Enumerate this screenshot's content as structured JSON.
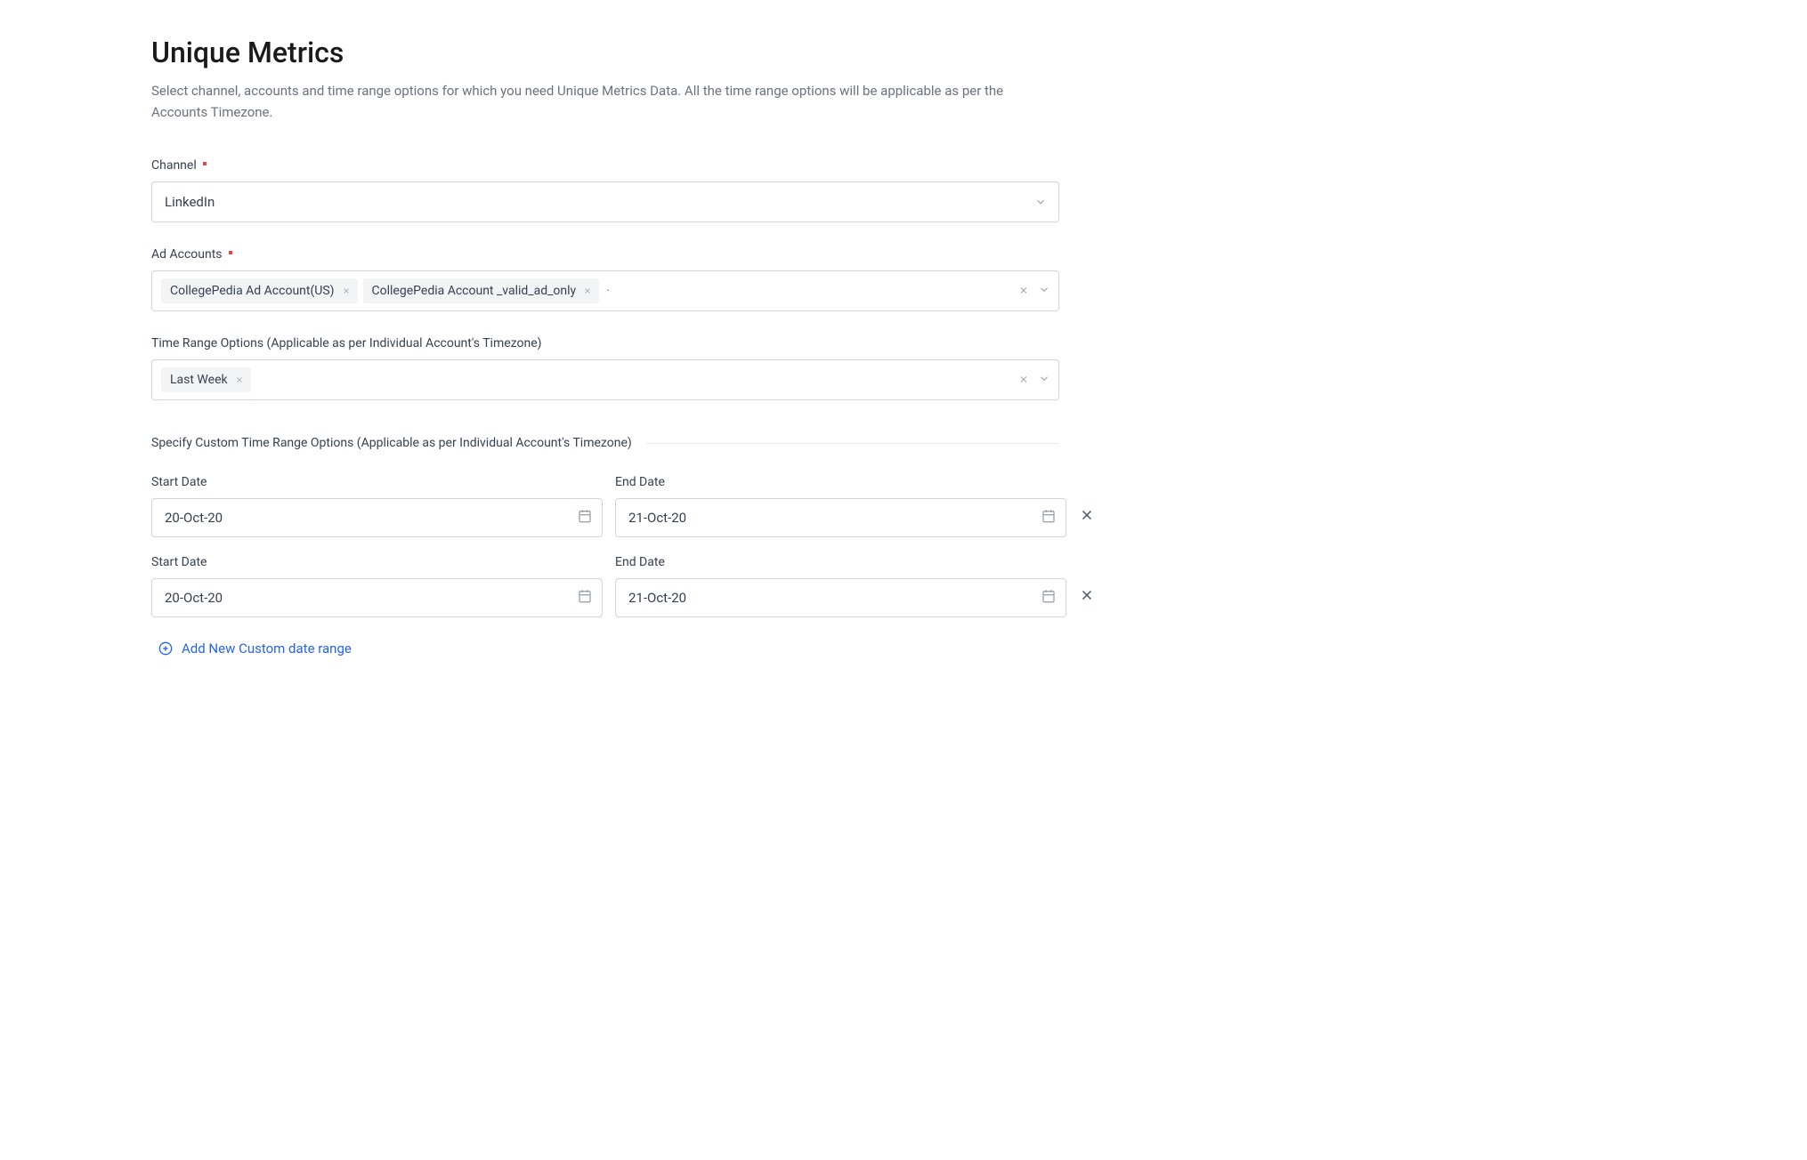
{
  "page": {
    "title": "Unique Metrics",
    "description": "Select channel, accounts and time range options for which you need Unique Metrics Data. All the time range options will be applicable as per the Accounts Timezone."
  },
  "channel": {
    "label": "Channel",
    "value": "LinkedIn"
  },
  "adAccounts": {
    "label": "Ad Accounts",
    "tags": [
      "CollegePedia Ad Account(US)",
      "CollegePedia Account _valid_ad_only"
    ]
  },
  "timeRange": {
    "label": "Time Range Options (Applicable as per Individual Account's Timezone)",
    "tags": [
      "Last Week"
    ]
  },
  "customSection": {
    "label": "Specify Custom Time Range Options (Applicable as per Individual Account's Timezone)"
  },
  "dateRows": [
    {
      "startLabel": "Start Date",
      "startValue": "20-Oct-20",
      "endLabel": "End Date",
      "endValue": "21-Oct-20"
    },
    {
      "startLabel": "Start Date",
      "startValue": "20-Oct-20",
      "endLabel": "End Date",
      "endValue": "21-Oct-20"
    }
  ],
  "addLink": {
    "label": "Add New Custom date range"
  }
}
